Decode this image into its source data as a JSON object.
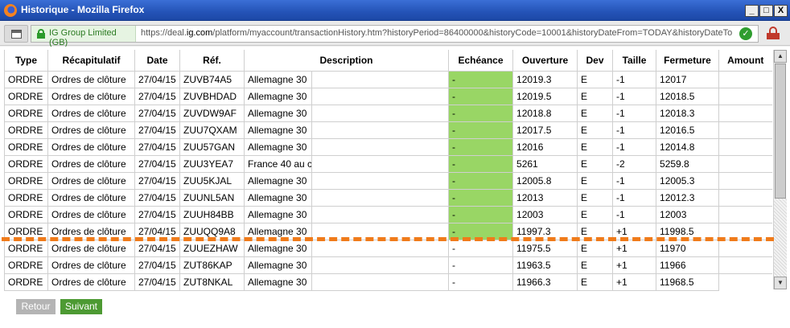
{
  "window": {
    "title": "Historique - Mozilla Firefox",
    "min_label": "_",
    "max_label": "□",
    "close_label": "X"
  },
  "addressbar": {
    "site_identity": "IG Group Limited (GB)",
    "url_prefix": "https://deal.",
    "url_domain": "ig.com",
    "url_rest": "/platform/myaccount/transactionHistory.htm?historyPeriod=86400000&historyCode=10001&historyDateFrom=TODAY&historyDateTo",
    "check_label": "✓"
  },
  "table": {
    "headers": {
      "type": "Type",
      "summary": "Récapitulatif",
      "date": "Date",
      "ref": "Réf.",
      "description": "Description",
      "expiry": "Echéance",
      "opening": "Ouverture",
      "currency": "Dev",
      "size": "Taille",
      "closing": "Fermeture",
      "amount": "Amount"
    },
    "rows": [
      {
        "type": "ORDRE",
        "summary": "Ordres de clôture",
        "date": "27/04/15",
        "ref": "ZUVB74A5",
        "description": "Allemagne 30",
        "expiry": "-",
        "opening": "12019.3",
        "currency": "E",
        "size": "-1",
        "closing": "12017"
      },
      {
        "type": "ORDRE",
        "summary": "Ordres de clôture",
        "date": "27/04/15",
        "ref": "ZUVBHDAD",
        "description": "Allemagne 30",
        "expiry": "-",
        "opening": "12019.5",
        "currency": "E",
        "size": "-1",
        "closing": "12018.5"
      },
      {
        "type": "ORDRE",
        "summary": "Ordres de clôture",
        "date": "27/04/15",
        "ref": "ZUVDW9AF",
        "description": "Allemagne 30",
        "expiry": "-",
        "opening": "12018.8",
        "currency": "E",
        "size": "-1",
        "closing": "12018.3"
      },
      {
        "type": "ORDRE",
        "summary": "Ordres de clôture",
        "date": "27/04/15",
        "ref": "ZUU7QXAM",
        "description": "Allemagne 30",
        "expiry": "-",
        "opening": "12017.5",
        "currency": "E",
        "size": "-1",
        "closing": "12016.5"
      },
      {
        "type": "ORDRE",
        "summary": "Ordres de clôture",
        "date": "27/04/15",
        "ref": "ZUU57GAN",
        "description": "Allemagne 30",
        "expiry": "-",
        "opening": "12016",
        "currency": "E",
        "size": "-1",
        "closing": "12014.8"
      },
      {
        "type": "ORDRE",
        "summary": "Ordres de clôture",
        "date": "27/04/15",
        "ref": "ZUU3YEA7",
        "description": "France 40 au c",
        "expiry": "-",
        "opening": "5261",
        "currency": "E",
        "size": "-2",
        "closing": "5259.8"
      },
      {
        "type": "ORDRE",
        "summary": "Ordres de clôture",
        "date": "27/04/15",
        "ref": "ZUU5KJAL",
        "description": "Allemagne 30",
        "expiry": "-",
        "opening": "12005.8",
        "currency": "E",
        "size": "-1",
        "closing": "12005.3"
      },
      {
        "type": "ORDRE",
        "summary": "Ordres de clôture",
        "date": "27/04/15",
        "ref": "ZUUNL5AN",
        "description": "Allemagne 30",
        "expiry": "-",
        "opening": "12013",
        "currency": "E",
        "size": "-1",
        "closing": "12012.3"
      },
      {
        "type": "ORDRE",
        "summary": "Ordres de clôture",
        "date": "27/04/15",
        "ref": "ZUUH84BB",
        "description": "Allemagne 30",
        "expiry": "-",
        "opening": "12003",
        "currency": "E",
        "size": "-1",
        "closing": "12003"
      },
      {
        "type": "ORDRE",
        "summary": "Ordres de clôture",
        "date": "27/04/15",
        "ref": "ZUUQQ9A8",
        "description": "Allemagne 30",
        "expiry": "-",
        "opening": "11997.3",
        "currency": "E",
        "size": "+1",
        "closing": "11998.5"
      },
      {
        "type": "ORDRE",
        "summary": "Ordres de clôture",
        "date": "27/04/15",
        "ref": "ZUUEZHAW",
        "description": "Allemagne 30",
        "expiry": "-",
        "opening": "11975.5",
        "currency": "E",
        "size": "+1",
        "closing": "11970"
      },
      {
        "type": "ORDRE",
        "summary": "Ordres de clôture",
        "date": "27/04/15",
        "ref": "ZUT86KAP",
        "description": "Allemagne 30",
        "expiry": "-",
        "opening": "11963.5",
        "currency": "E",
        "size": "+1",
        "closing": "11966"
      },
      {
        "type": "ORDRE",
        "summary": "Ordres de clôture",
        "date": "27/04/15",
        "ref": "ZUT8NKAL",
        "description": "Allemagne 30",
        "expiry": "-",
        "opening": "11966.3",
        "currency": "E",
        "size": "+1",
        "closing": "11968.5"
      }
    ],
    "highlighted_rows": 10,
    "highlight_color": "#99d665"
  },
  "scroll": {
    "up_label": "▲",
    "down_label": "▼"
  },
  "annotation": {
    "color": "#f07b1a"
  },
  "pager": {
    "back_label": "Retour",
    "next_label": "Suivant",
    "back_color": "#b4b4b4",
    "next_color": "#4d9a33"
  }
}
